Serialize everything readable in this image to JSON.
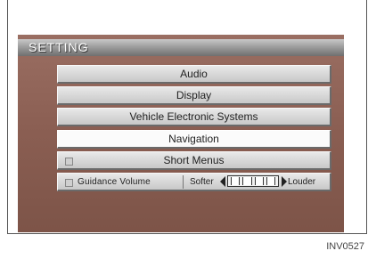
{
  "screen": {
    "title": "SETTING",
    "menu": [
      {
        "id": "audio",
        "label": "Audio"
      },
      {
        "id": "display",
        "label": "Display"
      },
      {
        "id": "vehicle",
        "label": "Vehicle Electronic Systems"
      },
      {
        "id": "navigation",
        "label": "Navigation",
        "selected": true
      },
      {
        "id": "short-menus",
        "label": "Short Menus",
        "checkbox": false
      }
    ],
    "guidance_volume": {
      "label": "Guidance Volume",
      "softer_label": "Softer",
      "louder_label": "Louder",
      "level_fraction": 0.5,
      "checkbox": false
    }
  },
  "caption": "INV0527",
  "colors": {
    "screen_background": "#8a5e52",
    "title_bar": "#9e9e9e",
    "button_face": "#d8d8d8",
    "selected_button": "#fbfbfb"
  }
}
